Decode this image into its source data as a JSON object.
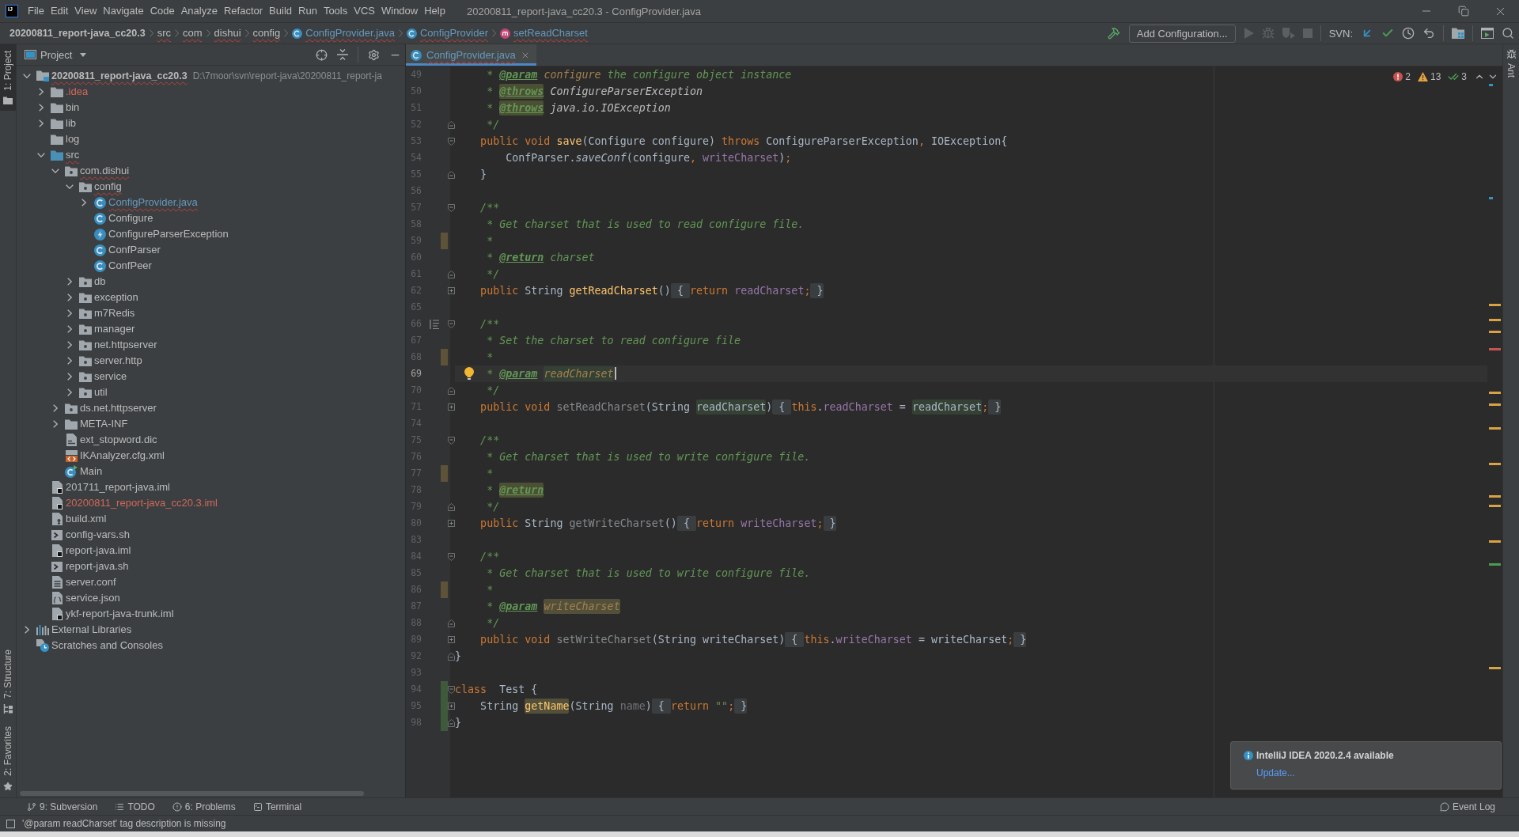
{
  "window": {
    "logo": "IJ",
    "title": "20200811_report-java_cc20.3 - ConfigProvider.java"
  },
  "menu": [
    "File",
    "Edit",
    "View",
    "Navigate",
    "Code",
    "Analyze",
    "Refactor",
    "Build",
    "Run",
    "Tools",
    "VCS",
    "Window",
    "Help"
  ],
  "breadcrumbs": [
    {
      "label": "20200811_report-java_cc20.3",
      "kind": "project",
      "problem": false
    },
    {
      "label": "src",
      "kind": "folder",
      "problem": true
    },
    {
      "label": "com",
      "kind": "folder",
      "problem": true
    },
    {
      "label": "dishui",
      "kind": "folder",
      "problem": true
    },
    {
      "label": "config",
      "kind": "folder",
      "problem": true
    },
    {
      "label": "ConfigProvider.java",
      "kind": "class",
      "problem": true,
      "color": "#6897bb"
    },
    {
      "label": "ConfigProvider",
      "kind": "class",
      "problem": true,
      "color": "#6897bb"
    },
    {
      "label": "setReadCharset",
      "kind": "method",
      "problem": true,
      "color": "#6897bb"
    }
  ],
  "toolbar": [
    {
      "kind": "build",
      "disabled": false
    },
    {
      "kind": "configuration",
      "label": "Add Configuration...",
      "disabled": false
    },
    {
      "kind": "run",
      "disabled": true
    },
    {
      "kind": "debug",
      "disabled": true
    },
    {
      "kind": "coverage",
      "disabled": true
    },
    {
      "kind": "stop",
      "disabled": true
    },
    {
      "kind": "label",
      "label": "SVN:"
    },
    {
      "kind": "update",
      "disabled": false
    },
    {
      "kind": "commit",
      "disabled": false
    },
    {
      "kind": "history",
      "disabled": false
    },
    {
      "kind": "revert",
      "disabled": false
    },
    {
      "kind": "structure",
      "disabled": false
    },
    {
      "kind": "terminal",
      "disabled": false
    },
    {
      "kind": "search",
      "disabled": false
    }
  ],
  "left_strip": {
    "top": [
      {
        "label": "1: Project",
        "kind": "project",
        "selected": true
      }
    ],
    "bottom": [
      {
        "label": "7: Structure",
        "kind": "structure",
        "selected": false
      },
      {
        "label": "2: Favorites",
        "kind": "favorites",
        "selected": false
      }
    ]
  },
  "project": {
    "title": "Project",
    "tree": [
      {
        "label": "20200811_report-java_cc20.3",
        "path": "D:\\7moor\\svn\\report-java\\20200811_report-ja",
        "kind": "module",
        "expanded": true,
        "problem": true,
        "children": [
          {
            "label": ".idea",
            "kind": "folder",
            "expanded": false,
            "color": "#d1675a"
          },
          {
            "label": "bin",
            "kind": "folder",
            "expanded": false
          },
          {
            "label": "lib",
            "kind": "folder",
            "expanded": false
          },
          {
            "label": "log",
            "kind": "folder"
          },
          {
            "label": "src",
            "kind": "source",
            "expanded": true,
            "problem": true,
            "children": [
              {
                "label": "com.dishui",
                "kind": "package",
                "expanded": true,
                "problem": true,
                "children": [
                  {
                    "label": "config",
                    "kind": "package",
                    "expanded": true,
                    "problem": true,
                    "children": [
                      {
                        "label": "ConfigProvider.java",
                        "kind": "class",
                        "expanded": false,
                        "problem": true,
                        "color": "#6897bb"
                      },
                      {
                        "label": "Configure",
                        "kind": "class"
                      },
                      {
                        "label": "ConfigureParserException",
                        "kind": "exception"
                      },
                      {
                        "label": "ConfParser",
                        "kind": "class"
                      },
                      {
                        "label": "ConfPeer",
                        "kind": "class"
                      }
                    ]
                  },
                  {
                    "label": "db",
                    "kind": "package",
                    "expanded": false
                  },
                  {
                    "label": "exception",
                    "kind": "package",
                    "expanded": false
                  },
                  {
                    "label": "m7Redis",
                    "kind": "package",
                    "expanded": false
                  },
                  {
                    "label": "manager",
                    "kind": "package",
                    "expanded": false
                  },
                  {
                    "label": "net.httpserver",
                    "kind": "package",
                    "expanded": false
                  },
                  {
                    "label": "server.http",
                    "kind": "package",
                    "expanded": false
                  },
                  {
                    "label": "service",
                    "kind": "package",
                    "expanded": false
                  },
                  {
                    "label": "util",
                    "kind": "package",
                    "expanded": false
                  }
                ]
              },
              {
                "label": "ds.net.httpserver",
                "kind": "package",
                "expanded": false
              },
              {
                "label": "META-INF",
                "kind": "folder",
                "expanded": false
              },
              {
                "label": "ext_stopword.dic",
                "kind": "dictionary"
              },
              {
                "label": "IKAnalyzer.cfg.xml",
                "kind": "xml"
              },
              {
                "label": "Main",
                "kind": "main"
              }
            ]
          },
          {
            "label": "201711_report-java.iml",
            "kind": "iml"
          },
          {
            "label": "20200811_report-java_cc20.3.iml",
            "kind": "iml",
            "color": "#d1675a"
          },
          {
            "label": "build.xml",
            "kind": "ant"
          },
          {
            "label": "config-vars.sh",
            "kind": "shell"
          },
          {
            "label": "report-java.iml",
            "kind": "iml"
          },
          {
            "label": "report-java.sh",
            "kind": "shell"
          },
          {
            "label": "server.conf",
            "kind": "conf"
          },
          {
            "label": "service.json",
            "kind": "json"
          },
          {
            "label": "ykf-report-java-trunk.iml",
            "kind": "iml"
          }
        ]
      },
      {
        "label": "External Libraries",
        "kind": "libraries",
        "expanded": false
      },
      {
        "label": "Scratches and Consoles",
        "kind": "scratches"
      }
    ]
  },
  "editor": {
    "tabs": [
      {
        "label": "ConfigProvider.java",
        "selected": true,
        "problem": true,
        "color": "#6897bb"
      }
    ],
    "inspections": {
      "errors": "2",
      "warnings": "13",
      "weak_warnings": "3"
    },
    "lines": [
      {
        "number": "49",
        "current": false,
        "tokens": [
          {
            "kind": "comment",
            "text": "     * "
          },
          {
            "kind": "doctag",
            "text": "@param"
          },
          {
            "kind": "docparam",
            "text": " configure"
          },
          {
            "kind": "comment",
            "text": " the configure object instance"
          }
        ]
      },
      {
        "number": "50",
        "current": false,
        "tokens": [
          {
            "kind": "comment",
            "text": "     * "
          },
          {
            "kind": "doctag_warn",
            "text": "@throws"
          },
          {
            "kind": "docref",
            "text": " ConfigureParserException"
          }
        ]
      },
      {
        "number": "51",
        "current": false,
        "tokens": [
          {
            "kind": "comment",
            "text": "     * "
          },
          {
            "kind": "doctag_warn",
            "text": "@throws"
          },
          {
            "kind": "docref",
            "text": " java.io.IOException"
          }
        ]
      },
      {
        "number": "52",
        "current": false,
        "marks": [
          {
            "kind": "fold_end"
          }
        ],
        "tokens": [
          {
            "kind": "comment",
            "text": "     */"
          }
        ]
      },
      {
        "number": "53",
        "current": false,
        "marks": [
          {
            "kind": "fold_start"
          }
        ],
        "tokens": [
          {
            "kind": "keyword",
            "text": "    public"
          },
          {
            "kind": "keyword",
            "text": " void"
          },
          {
            "kind": "method",
            "text": " save"
          },
          {
            "kind": "plain",
            "text": "(Configure configure) "
          },
          {
            "kind": "keyword",
            "text": "throws"
          },
          {
            "kind": "plain",
            "text": " ConfigureParserException"
          },
          {
            "kind": "punct",
            "text": ","
          },
          {
            "kind": "plain",
            "text": " IOException{"
          }
        ]
      },
      {
        "number": "54",
        "current": false,
        "tokens": [
          {
            "kind": "plain",
            "text": "        ConfParser."
          },
          {
            "kind": "static",
            "text": "saveConf"
          },
          {
            "kind": "plain",
            "text": "(configure"
          },
          {
            "kind": "punct",
            "text": ","
          },
          {
            "kind": "field",
            "text": " writeCharset"
          },
          {
            "kind": "plain",
            "text": ")"
          },
          {
            "kind": "punct",
            "text": ";"
          }
        ]
      },
      {
        "number": "55",
        "current": false,
        "marks": [
          {
            "kind": "fold_end"
          }
        ],
        "tokens": [
          {
            "kind": "plain",
            "text": "    }"
          }
        ]
      },
      {
        "number": "56",
        "current": false
      },
      {
        "number": "57",
        "current": false,
        "marks": [
          {
            "kind": "fold_start"
          }
        ],
        "tokens": [
          {
            "kind": "comment",
            "text": "    /**"
          }
        ]
      },
      {
        "number": "58",
        "current": false,
        "tokens": [
          {
            "kind": "comment",
            "text": "     * Get charset that is used to read configure file."
          }
        ]
      },
      {
        "number": "59",
        "current": false,
        "marks": [
          {
            "kind": "modified"
          }
        ],
        "tokens": [
          {
            "kind": "comment",
            "text": "     *"
          }
        ]
      },
      {
        "number": "60",
        "current": false,
        "tokens": [
          {
            "kind": "comment",
            "text": "     * "
          },
          {
            "kind": "doctag",
            "text": "@return"
          },
          {
            "kind": "comment",
            "text": " charset"
          }
        ]
      },
      {
        "number": "61",
        "current": false,
        "marks": [
          {
            "kind": "fold_end"
          }
        ],
        "tokens": [
          {
            "kind": "comment",
            "text": "     */"
          }
        ]
      },
      {
        "number": "62",
        "current": false,
        "marks": [
          {
            "kind": "fold_collapsed"
          }
        ],
        "tokens": [
          {
            "kind": "keyword",
            "text": "    public"
          },
          {
            "kind": "plain",
            "text": " String "
          },
          {
            "kind": "method",
            "text": "getReadCharset"
          },
          {
            "kind": "plain",
            "text": "()"
          },
          {
            "kind": "fold",
            "text": " { "
          },
          {
            "kind": "keyword",
            "text": "return"
          },
          {
            "kind": "field",
            "text": " readCharset"
          },
          {
            "kind": "punct",
            "text": ";"
          },
          {
            "kind": "fold",
            "text": " }"
          }
        ]
      },
      {
        "number": "65",
        "current": false
      },
      {
        "number": "66",
        "current": false,
        "marks": [
          {
            "kind": "doc_toggle"
          },
          {
            "kind": "fold_start"
          }
        ],
        "tokens": [
          {
            "kind": "comment",
            "text": "    /**"
          }
        ]
      },
      {
        "number": "67",
        "current": false,
        "tokens": [
          {
            "kind": "comment",
            "text": "     * Set the charset to read configure file"
          }
        ]
      },
      {
        "number": "68",
        "current": false,
        "marks": [
          {
            "kind": "modified"
          }
        ],
        "tokens": [
          {
            "kind": "comment",
            "text": "     *"
          }
        ]
      },
      {
        "number": "69",
        "current": true,
        "marks": [
          {
            "kind": "intention"
          }
        ],
        "tokens": [
          {
            "kind": "comment",
            "text": "     * "
          },
          {
            "kind": "doctag",
            "text": "@param"
          },
          {
            "kind": "docparam_usage",
            "text": " readCharset"
          }
        ]
      },
      {
        "number": "70",
        "current": false,
        "marks": [
          {
            "kind": "fold_end"
          }
        ],
        "tokens": [
          {
            "kind": "comment",
            "text": "     */"
          }
        ]
      },
      {
        "number": "71",
        "current": false,
        "marks": [
          {
            "kind": "fold_collapsed"
          }
        ],
        "tokens": [
          {
            "kind": "keyword",
            "text": "    public"
          },
          {
            "kind": "keyword",
            "text": " void"
          },
          {
            "kind": "unused",
            "text": " setReadCharset"
          },
          {
            "kind": "plain",
            "text": "(String "
          },
          {
            "kind": "usage",
            "text": "readCharset"
          },
          {
            "kind": "plain",
            "text": ")"
          },
          {
            "kind": "fold",
            "text": " { "
          },
          {
            "kind": "keyword",
            "text": "this"
          },
          {
            "kind": "plain",
            "text": "."
          },
          {
            "kind": "field",
            "text": "readCharset"
          },
          {
            "kind": "plain",
            "text": " = "
          },
          {
            "kind": "usage",
            "text": "readCharset"
          },
          {
            "kind": "punct",
            "text": ";"
          },
          {
            "kind": "fold",
            "text": " }"
          }
        ]
      },
      {
        "number": "74",
        "current": false
      },
      {
        "number": "75",
        "current": false,
        "marks": [
          {
            "kind": "fold_start"
          }
        ],
        "tokens": [
          {
            "kind": "comment",
            "text": "    /**"
          }
        ]
      },
      {
        "number": "76",
        "current": false,
        "tokens": [
          {
            "kind": "comment",
            "text": "     * Get charset that is used to write configure file."
          }
        ]
      },
      {
        "number": "77",
        "current": false,
        "marks": [
          {
            "kind": "modified"
          }
        ],
        "tokens": [
          {
            "kind": "comment",
            "text": "     *"
          }
        ]
      },
      {
        "number": "78",
        "current": false,
        "tokens": [
          {
            "kind": "comment",
            "text": "     * "
          },
          {
            "kind": "doctag_warn",
            "text": "@return"
          }
        ]
      },
      {
        "number": "79",
        "current": false,
        "marks": [
          {
            "kind": "fold_end"
          }
        ],
        "tokens": [
          {
            "kind": "comment",
            "text": "     */"
          }
        ]
      },
      {
        "number": "80",
        "current": false,
        "marks": [
          {
            "kind": "fold_collapsed"
          }
        ],
        "tokens": [
          {
            "kind": "keyword",
            "text": "    public"
          },
          {
            "kind": "plain",
            "text": " String "
          },
          {
            "kind": "unused",
            "text": "getWriteCharset"
          },
          {
            "kind": "plain",
            "text": "()"
          },
          {
            "kind": "fold",
            "text": " { "
          },
          {
            "kind": "keyword",
            "text": "return"
          },
          {
            "kind": "field",
            "text": " writeCharset"
          },
          {
            "kind": "punct",
            "text": ";"
          },
          {
            "kind": "fold",
            "text": " }"
          }
        ]
      },
      {
        "number": "83",
        "current": false
      },
      {
        "number": "84",
        "current": false,
        "marks": [
          {
            "kind": "fold_start"
          }
        ],
        "tokens": [
          {
            "kind": "comment",
            "text": "    /**"
          }
        ]
      },
      {
        "number": "85",
        "current": false,
        "tokens": [
          {
            "kind": "comment",
            "text": "     * Get charset that is used to write configure file."
          }
        ]
      },
      {
        "number": "86",
        "current": false,
        "marks": [
          {
            "kind": "modified"
          }
        ],
        "tokens": [
          {
            "kind": "comment",
            "text": "     *"
          }
        ]
      },
      {
        "number": "87",
        "current": false,
        "tokens": [
          {
            "kind": "comment",
            "text": "     * "
          },
          {
            "kind": "doctag",
            "text": "@param"
          },
          {
            "kind": "docparam_warn",
            "text": " writeCharset"
          }
        ]
      },
      {
        "number": "88",
        "current": false,
        "marks": [
          {
            "kind": "fold_end"
          }
        ],
        "tokens": [
          {
            "kind": "comment",
            "text": "     */"
          }
        ]
      },
      {
        "number": "89",
        "current": false,
        "marks": [
          {
            "kind": "fold_collapsed"
          }
        ],
        "tokens": [
          {
            "kind": "keyword",
            "text": "    public"
          },
          {
            "kind": "keyword",
            "text": " void"
          },
          {
            "kind": "unused",
            "text": " setWriteCharset"
          },
          {
            "kind": "plain",
            "text": "(String writeCharset)"
          },
          {
            "kind": "fold",
            "text": " { "
          },
          {
            "kind": "keyword",
            "text": "this"
          },
          {
            "kind": "plain",
            "text": "."
          },
          {
            "kind": "field",
            "text": "writeCharset"
          },
          {
            "kind": "plain",
            "text": " = writeCharset"
          },
          {
            "kind": "punct",
            "text": ";"
          },
          {
            "kind": "fold",
            "text": " }"
          }
        ]
      },
      {
        "number": "92",
        "current": false,
        "marks": [
          {
            "kind": "fold_end"
          }
        ],
        "tokens": [
          {
            "kind": "plain",
            "text": "}"
          }
        ]
      },
      {
        "number": "93",
        "current": false
      },
      {
        "number": "94",
        "current": false,
        "marks": [
          {
            "kind": "added"
          },
          {
            "kind": "fold_start"
          }
        ],
        "tokens": [
          {
            "kind": "keyword",
            "text": "class"
          },
          {
            "kind": "plain",
            "text": "  Test {"
          }
        ]
      },
      {
        "number": "95",
        "current": false,
        "marks": [
          {
            "kind": "added"
          },
          {
            "kind": "fold_collapsed"
          }
        ],
        "tokens": [
          {
            "kind": "plain",
            "text": "    String "
          },
          {
            "kind": "method_warn",
            "text": "getName"
          },
          {
            "kind": "plain",
            "text": "(String "
          },
          {
            "kind": "param_unused",
            "text": "name"
          },
          {
            "kind": "plain",
            "text": ")"
          },
          {
            "kind": "fold",
            "text": " { "
          },
          {
            "kind": "keyword",
            "text": "return"
          },
          {
            "kind": "string",
            "text": " \"\""
          },
          {
            "kind": "punct",
            "text": ";"
          },
          {
            "kind": "fold",
            "text": " }"
          }
        ]
      },
      {
        "number": "98",
        "current": false,
        "marks": [
          {
            "kind": "added"
          },
          {
            "kind": "fold_end"
          }
        ],
        "tokens": [
          {
            "kind": "plain",
            "text": "}"
          }
        ]
      }
    ]
  },
  "right_strip": [
    {
      "label": "Ant",
      "kind": "ant",
      "selected": false
    }
  ],
  "notification": {
    "title": "IntelliJ IDEA 2020.2.4 available",
    "link": "Update..."
  },
  "bottom_tools": [
    {
      "label": "9: Subversion",
      "kind": "vcs"
    },
    {
      "label": "TODO",
      "kind": "todo"
    },
    {
      "label": "6: Problems",
      "kind": "problems"
    },
    {
      "label": "Terminal",
      "kind": "terminal"
    }
  ],
  "event_log": {
    "label": "Event Log"
  },
  "status_bar": {
    "message": "'@param readCharset' tag description is missing"
  }
}
